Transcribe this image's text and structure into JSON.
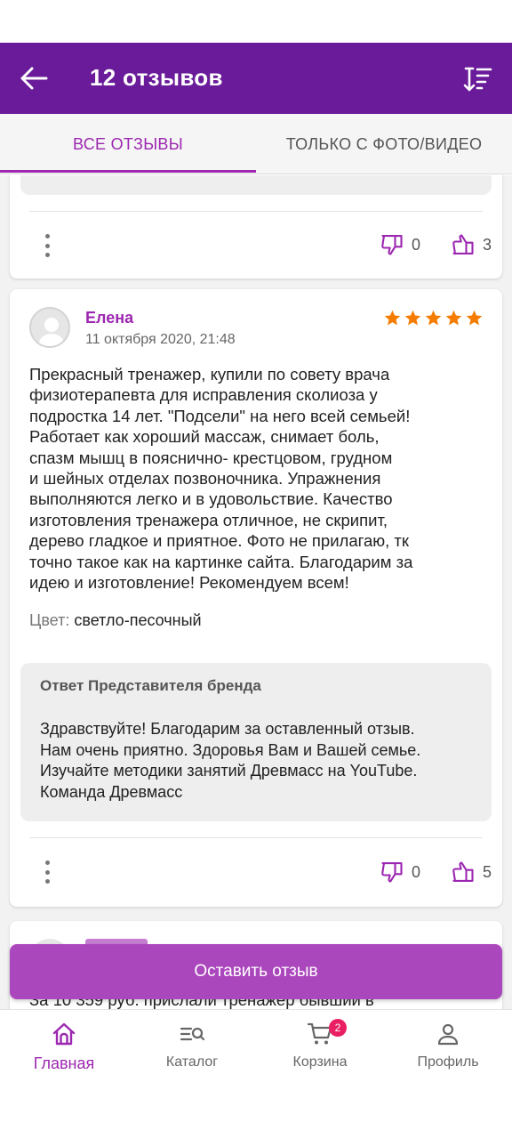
{
  "header": {
    "title": "12 отзывов",
    "back_icon": "arrow-left-icon",
    "sort_icon": "sort-icon"
  },
  "tabs": [
    {
      "label": "ВСЕ ОТЗЫВЫ",
      "active": true
    },
    {
      "label": "ТОЛЬКО С ФОТО/ВИДЕО",
      "active": false
    }
  ],
  "previous_review": {
    "dislikes": "0",
    "likes": "3"
  },
  "review": {
    "author": "Елена",
    "date": "11 октября 2020, 21:48",
    "rating": 5,
    "text": "Прекрасный тренажер, купили по совету врача\nфизиотерапевта для исправления сколиоза у\nподростка 14 лет. \"Подсели\" на него всей семьей!\nРаботает как хороший массаж, снимает боль,\nспазм мышц в пояснично- крестцовом, грудном\nи шейных отделах позвоночника. Упражнения\nвыполняются легко и в удовольствие. Качество\nизготовления тренажера отличное, не скрипит,\nдерево гладкое и приятное. Фото не прилагаю, тк\nточно такое как на картинке сайта. Благодарим за\nидею и изготовление! Рекомендуем всем!",
    "color_label": "Цвет:",
    "color_value": "светло-песочный",
    "reply": {
      "title": "Ответ Представителя бренда",
      "text": "Здравствуйте! Благодарим за оставленный отзыв.\nНам очень приятно. Здоровья Вам и Вашей семье.\nИзучайте методики занятий Древмасс на YouTube.\nКоманда Древмасс"
    },
    "dislikes": "0",
    "likes": "5"
  },
  "next_review": {
    "text_peek": "За 10 359 руб. прислали тренажер бывший в"
  },
  "cta": {
    "label": "Оставить отзыв"
  },
  "bottom_nav": [
    {
      "label": "Главная",
      "icon": "home-icon",
      "active": true
    },
    {
      "label": "Каталог",
      "icon": "catalog-search-icon",
      "active": false
    },
    {
      "label": "Корзина",
      "icon": "cart-icon",
      "active": false,
      "badge": "2"
    },
    {
      "label": "Профиль",
      "icon": "profile-icon",
      "active": false
    }
  ],
  "colors": {
    "header_bg": "#6a1b9a",
    "accent": "#9c27b0",
    "cta_bg": "#ab47bc",
    "star": "#f57c00",
    "badge": "#e91e63"
  }
}
